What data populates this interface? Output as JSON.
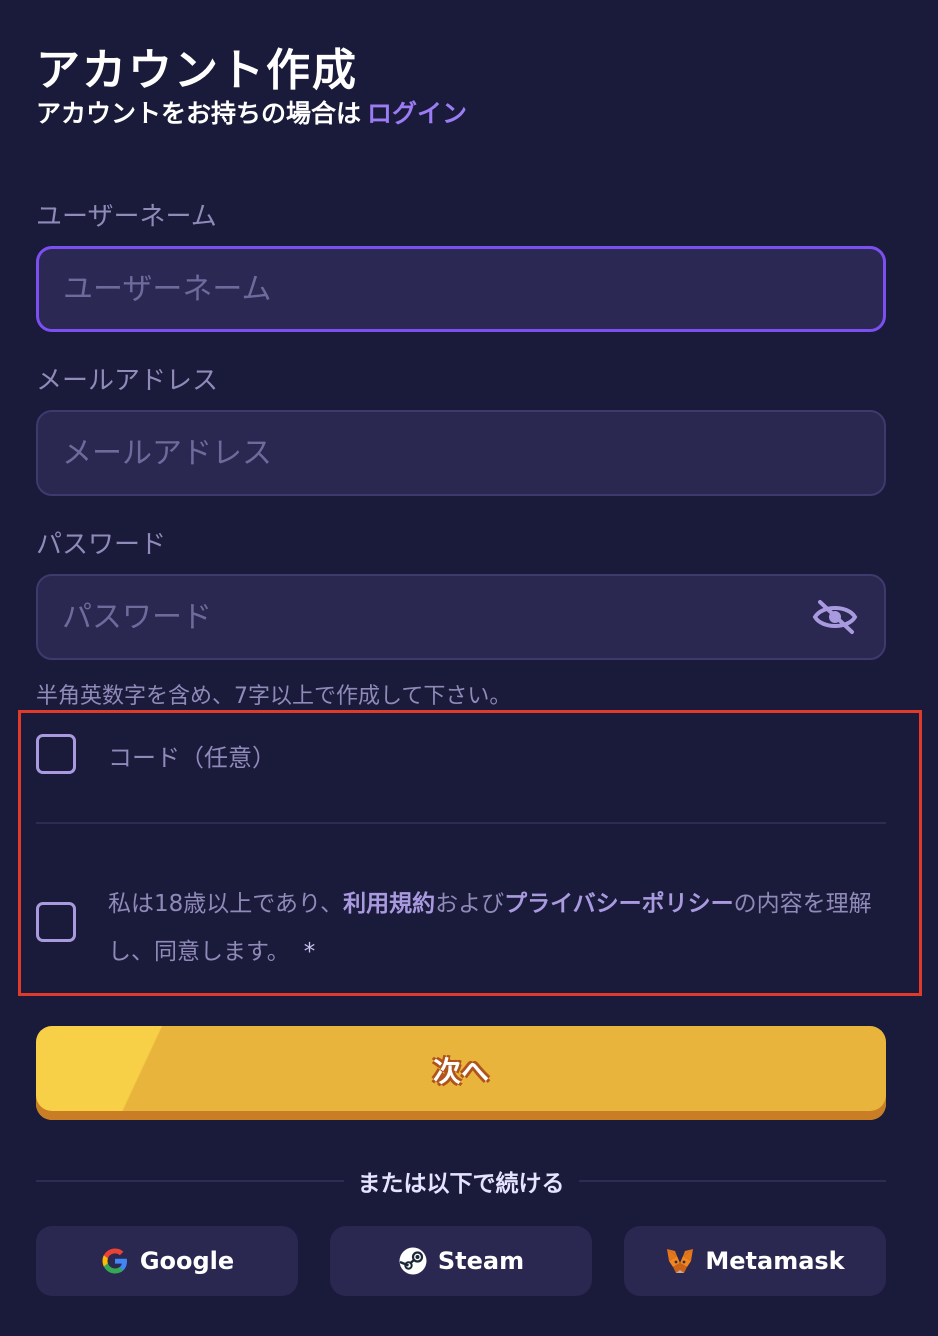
{
  "header": {
    "title": "アカウント作成",
    "subtitle": "アカウントをお持ちの場合は",
    "login_link": "ログイン"
  },
  "form": {
    "username": {
      "label": "ユーザーネーム",
      "placeholder": "ユーザーネーム"
    },
    "email": {
      "label": "メールアドレス",
      "placeholder": "メールアドレス"
    },
    "password": {
      "label": "パスワード",
      "placeholder": "パスワード",
      "hint": "半角英数字を含め、7字以上で作成して下さい。"
    },
    "code_label": "コード（任意）",
    "terms": {
      "prefix": "私は18歳以上であり、",
      "terms_link": "利用規約",
      "middle": "および",
      "privacy_link": "プライバシーポリシー",
      "suffix": "の内容を理解し、同意します。",
      "required_mark": "*"
    },
    "next_button": "次へ"
  },
  "social": {
    "divider_text": "または以下で続ける",
    "buttons": [
      {
        "label": "Google",
        "icon": "google-icon"
      },
      {
        "label": "Steam",
        "icon": "steam-icon"
      },
      {
        "label": "Metamask",
        "icon": "metamask-icon"
      }
    ]
  },
  "colors": {
    "background": "#1a1a3a",
    "accent": "#7b4ff0",
    "link": "#9b7cf5",
    "button_yellow": "#e8b43c",
    "highlight": "#e03a2a"
  }
}
